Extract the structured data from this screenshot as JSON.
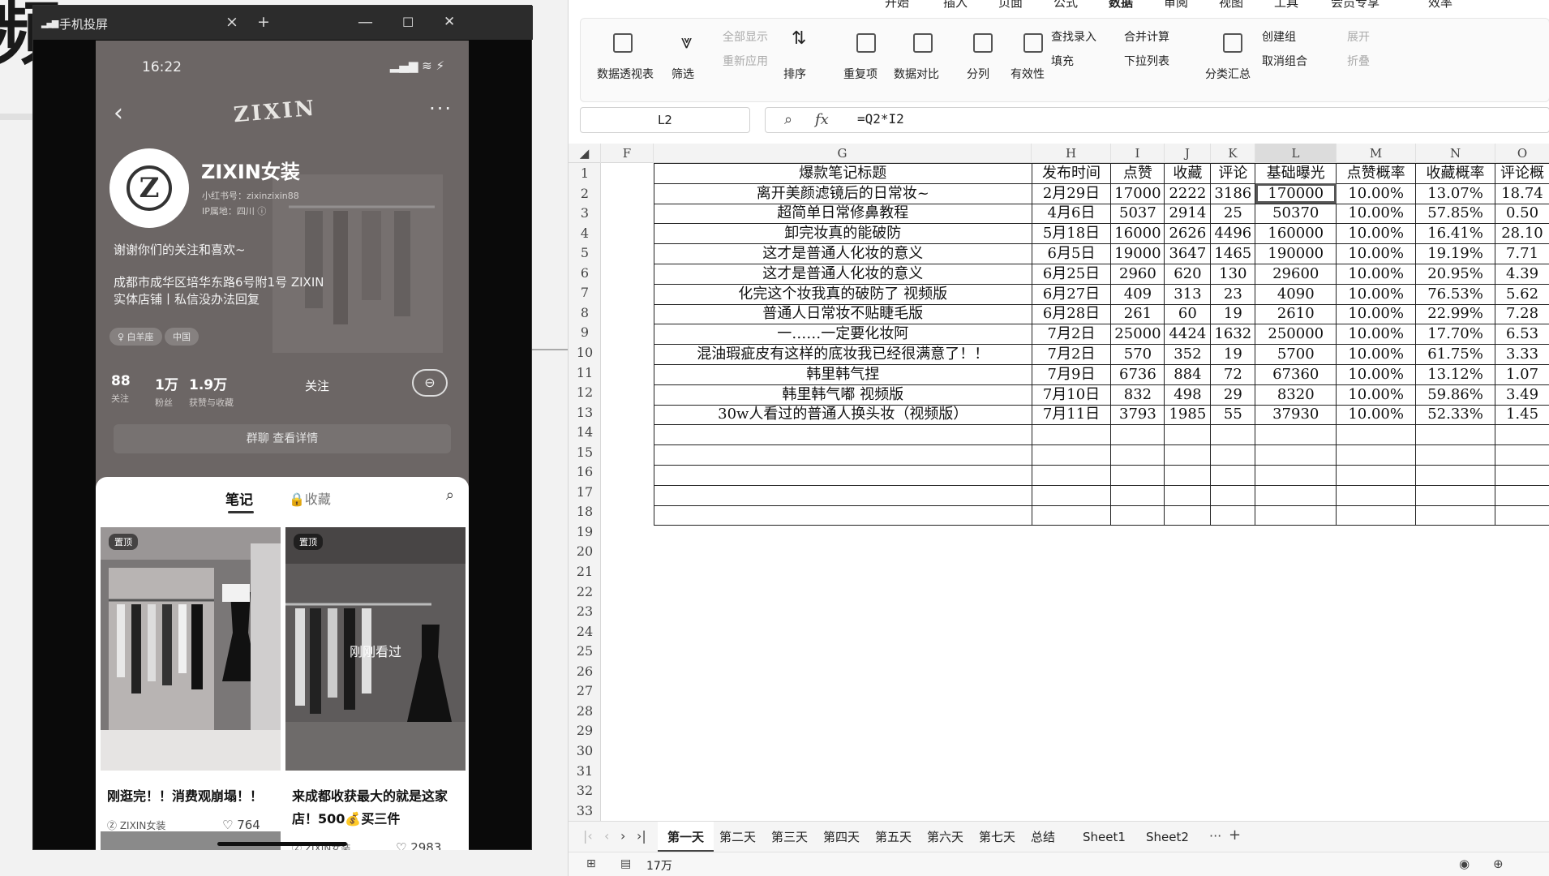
{
  "mirror": {
    "title": "手机投屏",
    "close": "×",
    "newtab": "+",
    "min": "—",
    "max": "☐",
    "winclose": "✕"
  },
  "phone": {
    "time": "16:22",
    "status_icons": "▂▄▆ ≋ ⚡",
    "brand": "ZIXIN",
    "name": "ZIXIN女装",
    "redbook_id": "小红书号：zixinzixin88",
    "ip": "IP属地：四川 ⓘ",
    "bio": "谢谢你们的关注和喜欢~",
    "address": [
      "成都市成华区培华东路6号附1号 ZIXIN",
      "实体店铺丨私信没办法回复"
    ],
    "tags": [
      "♀ 白羊座",
      "中国"
    ],
    "stats": [
      {
        "n": "88",
        "l": "关注"
      },
      {
        "n": "1万",
        "l": "粉丝"
      },
      {
        "n": "1.9万",
        "l": "获赞与收藏"
      }
    ],
    "follow": "关注",
    "group": "群聊  查看详情",
    "tabs": {
      "notes": "笔记",
      "collect": "🔒收藏"
    },
    "cards": [
      {
        "pin": "置顶",
        "title": "刚逛完！！消费观崩塌！！",
        "author": "ZIXIN女装",
        "likes": "♡ 764"
      },
      {
        "pin": "置顶",
        "seen": "刚刚看过",
        "title": "来成都收获最大的就是这家店！500💰买三件",
        "author": "ZIXIN女装",
        "likes": "♡ 2983"
      }
    ]
  },
  "ribbon": {
    "pivot": "数据透视表",
    "filter": "筛选",
    "showall": "全部显示",
    "reapply": "重新应用",
    "sort": "排序",
    "dup": "重复项",
    "compare": "数据对比",
    "split": "分列",
    "valid": "有效性",
    "lookup": "查找录入",
    "fill": "填充",
    "merge": "合并计算",
    "dropdown": "下拉列表",
    "subtotal": "分类汇总",
    "group": "创建组",
    "ungroup": "取消组合",
    "expand": "展开",
    "collapse": "折叠",
    "menu": [
      "开始",
      "插入",
      "页面",
      "公式",
      "数据",
      "审阅",
      "视图",
      "工具",
      "会员专享",
      "效率"
    ]
  },
  "formula": {
    "cell": "L2",
    "fx": "fx",
    "value": "=Q2*I2"
  },
  "columns": [
    "F",
    "G",
    "H",
    "I",
    "J",
    "K",
    "L",
    "M",
    "N",
    "O"
  ],
  "table": {
    "headers": [
      "爆款笔记标题",
      "发布时间",
      "点赞",
      "收藏",
      "评论",
      "基础曝光",
      "点赞概率",
      "收藏概率",
      "评论概"
    ],
    "rows": [
      [
        "离开美颜滤镜后的日常妆~",
        "2月29日",
        "17000",
        "2222",
        "3186",
        "170000",
        "10.00%",
        "13.07%",
        "18.74"
      ],
      [
        "超简单日常修鼻教程",
        "4月6日",
        "5037",
        "2914",
        "25",
        "50370",
        "10.00%",
        "57.85%",
        "0.50"
      ],
      [
        "卸完妆真的能破防",
        "5月18日",
        "16000",
        "2626",
        "4496",
        "160000",
        "10.00%",
        "16.41%",
        "28.10"
      ],
      [
        "这才是普通人化妆的意义",
        "6月5日",
        "19000",
        "3647",
        "1465",
        "190000",
        "10.00%",
        "19.19%",
        "7.71"
      ],
      [
        "这才是普通人化妆的意义",
        "6月25日",
        "2960",
        "620",
        "130",
        "29600",
        "10.00%",
        "20.95%",
        "4.39"
      ],
      [
        "化完这个妆我真的破防了 视频版",
        "6月27日",
        "409",
        "313",
        "23",
        "4090",
        "10.00%",
        "76.53%",
        "5.62"
      ],
      [
        "普通人日常妆不贴睫毛版",
        "6月28日",
        "261",
        "60",
        "19",
        "2610",
        "10.00%",
        "22.99%",
        "7.28"
      ],
      [
        "一……一定要化妆阿",
        "7月2日",
        "25000",
        "4424",
        "1632",
        "250000",
        "10.00%",
        "17.70%",
        "6.53"
      ],
      [
        "混油瑕疵皮有这样的底妆我已经很满意了！！",
        "7月2日",
        "570",
        "352",
        "19",
        "5700",
        "10.00%",
        "61.75%",
        "3.33"
      ],
      [
        "韩里韩气捏",
        "7月9日",
        "6736",
        "884",
        "72",
        "67360",
        "10.00%",
        "13.12%",
        "1.07"
      ],
      [
        "韩里韩气嘟 视频版",
        "7月10日",
        "832",
        "498",
        "29",
        "8320",
        "10.00%",
        "59.86%",
        "3.49"
      ],
      [
        "30w人看过的普通人换头妆（视频版）",
        "7月11日",
        "3793",
        "1985",
        "55",
        "37930",
        "10.00%",
        "52.33%",
        "1.45"
      ]
    ]
  },
  "sheets": [
    "第一天",
    "第二天",
    "第三天",
    "第四天",
    "第五天",
    "第六天",
    "第七天",
    "总结",
    "Sheet1",
    "Sheet2"
  ],
  "status": {
    "count": "17万"
  }
}
